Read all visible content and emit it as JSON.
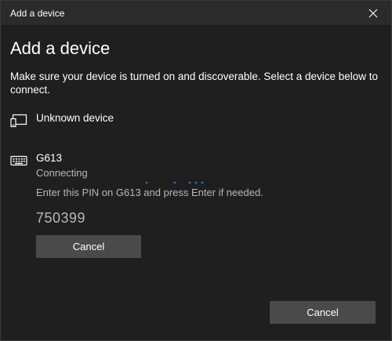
{
  "window": {
    "title": "Add a device"
  },
  "icons": {
    "close": "close-icon",
    "unknown_device": "display-device-icon",
    "keyboard": "keyboard-icon"
  },
  "heading": "Add a device",
  "description": "Make sure your device is turned on and discoverable. Select a device below to connect.",
  "devices": [
    {
      "name": "Unknown device"
    },
    {
      "name": "G613",
      "status": "Connecting"
    }
  ],
  "pairing": {
    "instruction": "Enter this PIN on G613 and press Enter if needed.",
    "pin": "750399",
    "cancel_label": "Cancel"
  },
  "footer": {
    "cancel_label": "Cancel"
  },
  "colors": {
    "accent": "#2d7dd2",
    "background": "#1f1f1f",
    "titlebar": "#2b2b2b",
    "button": "#4a4a4a",
    "secondary_text": "#b8b8b8"
  }
}
